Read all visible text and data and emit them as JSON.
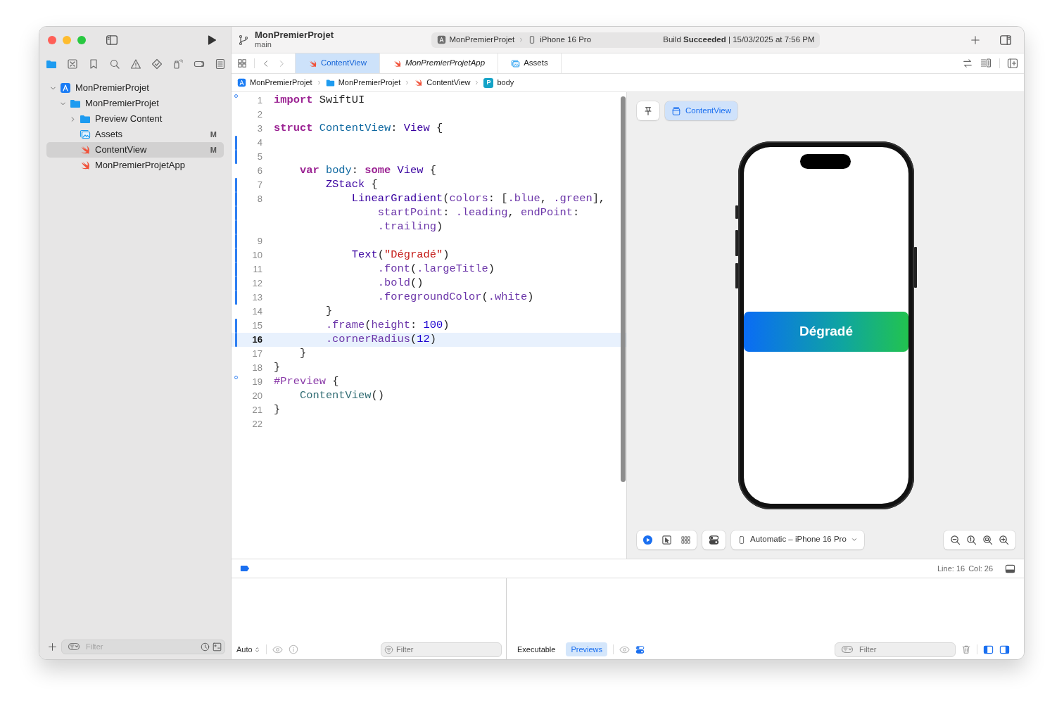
{
  "toolbar": {
    "title": "MonPremierProjet",
    "branch": "main",
    "scheme": "MonPremierProjet",
    "destination": "iPhone 16 Pro",
    "status": "Build **Succeeded** | 15/03/2025 at 7:56 PM"
  },
  "navigator": {
    "tabs": [
      {
        "kind": "files",
        "selected": true
      },
      {
        "kind": "source-control",
        "selected": false
      },
      {
        "kind": "bookmarks",
        "selected": false
      },
      {
        "kind": "search",
        "selected": false
      },
      {
        "kind": "issues",
        "selected": false
      },
      {
        "kind": "tests",
        "selected": false
      },
      {
        "kind": "debug",
        "selected": false
      },
      {
        "kind": "breakpoints",
        "selected": false
      },
      {
        "kind": "reports",
        "selected": false
      }
    ],
    "tree": [
      {
        "label": "MonPremierProjet",
        "kind": "project",
        "expanded": true,
        "selected": false,
        "children": [
          {
            "label": "MonPremierProjet",
            "kind": "folder",
            "expanded": true,
            "selected": false,
            "children": [
              {
                "label": "Preview Content",
                "kind": "folder",
                "expanded": false,
                "selected": false
              },
              {
                "label": "Assets",
                "kind": "assets",
                "badge": "M",
                "selected": false
              },
              {
                "label": "ContentView",
                "kind": "swift",
                "badge": "M",
                "selected": true
              },
              {
                "label": "MonPremierProjetApp",
                "kind": "swift",
                "selected": false
              }
            ]
          }
        ]
      }
    ],
    "filter_placeholder": "Filter"
  },
  "editor_tabs": [
    {
      "label": "ContentView",
      "kind": "swift",
      "selected": true,
      "italic": false
    },
    {
      "label": "MonPremierProjetApp",
      "kind": "swift",
      "selected": false,
      "italic": true
    },
    {
      "label": "Assets",
      "kind": "assets",
      "selected": false,
      "italic": false
    }
  ],
  "jump_bar": [
    {
      "label": "MonPremierProjet",
      "kind": "project"
    },
    {
      "label": "MonPremierProjet",
      "kind": "folder"
    },
    {
      "label": "ContentView",
      "kind": "swift"
    },
    {
      "label": "body",
      "kind": "property",
      "icon_letter": "P"
    }
  ],
  "code": {
    "lines": [
      {
        "number": "1",
        "changed": false,
        "marked": true,
        "current": false,
        "rows": [
          {
            "tokens": [
              {
                "kind": "keyword",
                "text": "import"
              },
              {
                "kind": "plain",
                "text": " SwiftUI"
              }
            ]
          }
        ]
      },
      {
        "number": "2",
        "changed": false,
        "marked": false,
        "current": false,
        "rows": [
          {
            "tokens": []
          }
        ]
      },
      {
        "number": "3",
        "changed": false,
        "marked": false,
        "current": false,
        "rows": [
          {
            "tokens": [
              {
                "kind": "keyword",
                "text": "struct "
              },
              {
                "kind": "decl",
                "text": "ContentView"
              },
              {
                "kind": "plain",
                "text": ": "
              },
              {
                "kind": "type",
                "text": "View"
              },
              {
                "kind": "plain",
                "text": " {"
              }
            ]
          }
        ]
      },
      {
        "number": "4",
        "changed": true,
        "marked": false,
        "current": false,
        "rows": [
          {
            "tokens": []
          }
        ]
      },
      {
        "number": "5",
        "changed": true,
        "marked": false,
        "current": false,
        "rows": [
          {
            "tokens": []
          }
        ]
      },
      {
        "number": "6",
        "changed": false,
        "marked": false,
        "current": false,
        "rows": [
          {
            "tokens": [
              {
                "kind": "keyword",
                "text": "    var "
              },
              {
                "kind": "decl",
                "text": "body"
              },
              {
                "kind": "plain",
                "text": ": "
              },
              {
                "kind": "keyword",
                "text": "some "
              },
              {
                "kind": "type",
                "text": "View"
              },
              {
                "kind": "plain",
                "text": " {"
              }
            ]
          }
        ]
      },
      {
        "number": "7",
        "changed": true,
        "marked": false,
        "current": false,
        "rows": [
          {
            "tokens": [
              {
                "kind": "type",
                "text": "        ZStack"
              },
              {
                "kind": "plain",
                "text": " {"
              }
            ]
          }
        ]
      },
      {
        "number": "8",
        "changed": true,
        "marked": false,
        "current": false,
        "rows": [
          {
            "tokens": [
              {
                "kind": "type",
                "text": "            LinearGradient"
              },
              {
                "kind": "plain",
                "text": "("
              },
              {
                "kind": "member",
                "text": "colors"
              },
              {
                "kind": "plain",
                "text": ": ["
              },
              {
                "kind": "member",
                "text": ".blue"
              },
              {
                "kind": "plain",
                "text": ", "
              },
              {
                "kind": "member",
                "text": ".green"
              },
              {
                "kind": "plain",
                "text": "],"
              }
            ]
          },
          {
            "tokens": [
              {
                "kind": "member",
                "text": "                startPoint"
              },
              {
                "kind": "plain",
                "text": ": "
              },
              {
                "kind": "member",
                "text": ".leading"
              },
              {
                "kind": "plain",
                "text": ", "
              },
              {
                "kind": "member",
                "text": "endPoint"
              },
              {
                "kind": "plain",
                "text": ":"
              }
            ]
          },
          {
            "tokens": [
              {
                "kind": "member",
                "text": "                .trailing"
              },
              {
                "kind": "plain",
                "text": ")"
              }
            ]
          }
        ]
      },
      {
        "number": "9",
        "changed": true,
        "marked": false,
        "current": false,
        "rows": [
          {
            "tokens": []
          }
        ]
      },
      {
        "number": "10",
        "changed": true,
        "marked": false,
        "current": false,
        "rows": [
          {
            "tokens": [
              {
                "kind": "type",
                "text": "            Text"
              },
              {
                "kind": "plain",
                "text": "("
              },
              {
                "kind": "string",
                "text": "\"Dégradé\""
              },
              {
                "kind": "plain",
                "text": ")"
              }
            ]
          }
        ]
      },
      {
        "number": "11",
        "changed": true,
        "marked": false,
        "current": false,
        "rows": [
          {
            "tokens": [
              {
                "kind": "member",
                "text": "                .font"
              },
              {
                "kind": "plain",
                "text": "("
              },
              {
                "kind": "member",
                "text": ".largeTitle"
              },
              {
                "kind": "plain",
                "text": ")"
              }
            ]
          }
        ]
      },
      {
        "number": "12",
        "changed": true,
        "marked": false,
        "current": false,
        "rows": [
          {
            "tokens": [
              {
                "kind": "member",
                "text": "                .bold"
              },
              {
                "kind": "plain",
                "text": "()"
              }
            ]
          }
        ]
      },
      {
        "number": "13",
        "changed": true,
        "marked": false,
        "current": false,
        "rows": [
          {
            "tokens": [
              {
                "kind": "member",
                "text": "                .foregroundColor"
              },
              {
                "kind": "plain",
                "text": "("
              },
              {
                "kind": "member",
                "text": ".white"
              },
              {
                "kind": "plain",
                "text": ")"
              }
            ]
          }
        ]
      },
      {
        "number": "14",
        "changed": false,
        "marked": false,
        "current": false,
        "rows": [
          {
            "tokens": [
              {
                "kind": "plain",
                "text": "        }"
              }
            ]
          }
        ]
      },
      {
        "number": "15",
        "changed": true,
        "marked": false,
        "current": false,
        "rows": [
          {
            "tokens": [
              {
                "kind": "member",
                "text": "        .frame"
              },
              {
                "kind": "plain",
                "text": "("
              },
              {
                "kind": "member",
                "text": "height"
              },
              {
                "kind": "plain",
                "text": ": "
              },
              {
                "kind": "number",
                "text": "100"
              },
              {
                "kind": "plain",
                "text": ")"
              }
            ]
          }
        ]
      },
      {
        "number": "16",
        "changed": true,
        "marked": false,
        "current": true,
        "rows": [
          {
            "tokens": [
              {
                "kind": "member",
                "text": "        .cornerRadius"
              },
              {
                "kind": "plain",
                "text": "("
              },
              {
                "kind": "number",
                "text": "12"
              },
              {
                "kind": "plain",
                "text": ")"
              }
            ]
          }
        ]
      },
      {
        "number": "17",
        "changed": false,
        "marked": false,
        "current": false,
        "rows": [
          {
            "tokens": [
              {
                "kind": "plain",
                "text": "    }"
              }
            ]
          }
        ]
      },
      {
        "number": "18",
        "changed": false,
        "marked": false,
        "current": false,
        "rows": [
          {
            "tokens": [
              {
                "kind": "plain",
                "text": "}"
              }
            ]
          }
        ]
      },
      {
        "number": "19",
        "changed": false,
        "marked": true,
        "current": false,
        "rows": [
          {
            "tokens": [
              {
                "kind": "directive",
                "text": "#Preview"
              },
              {
                "kind": "plain",
                "text": " {"
              }
            ]
          }
        ]
      },
      {
        "number": "20",
        "changed": false,
        "marked": false,
        "current": false,
        "rows": [
          {
            "tokens": [
              {
                "kind": "usertype",
                "text": "    ContentView"
              },
              {
                "kind": "plain",
                "text": "()"
              }
            ]
          }
        ]
      },
      {
        "number": "21",
        "changed": false,
        "marked": false,
        "current": false,
        "rows": [
          {
            "tokens": [
              {
                "kind": "plain",
                "text": "}"
              }
            ]
          }
        ]
      },
      {
        "number": "22",
        "changed": false,
        "marked": false,
        "current": false,
        "rows": [
          {
            "tokens": []
          }
        ]
      }
    ]
  },
  "preview": {
    "tabs": [
      {
        "label": "ContentView",
        "selected": true
      }
    ],
    "banner_text": "Dégradé",
    "modes": [
      {
        "kind": "live",
        "selected": true
      },
      {
        "kind": "select",
        "selected": false
      },
      {
        "kind": "variants",
        "selected": false
      }
    ],
    "device_menu": "Automatic – iPhone 16 Pro"
  },
  "status_bar": {
    "line": "Line: 16",
    "column": "Col: 26"
  },
  "debug_area": {
    "variables": {
      "scope": "Auto",
      "filter_placeholder": "Filter"
    },
    "console": {
      "sources": [
        {
          "label": "Executable",
          "selected": false
        },
        {
          "label": "Previews",
          "selected": true
        }
      ],
      "filter_placeholder": "Filter"
    }
  }
}
